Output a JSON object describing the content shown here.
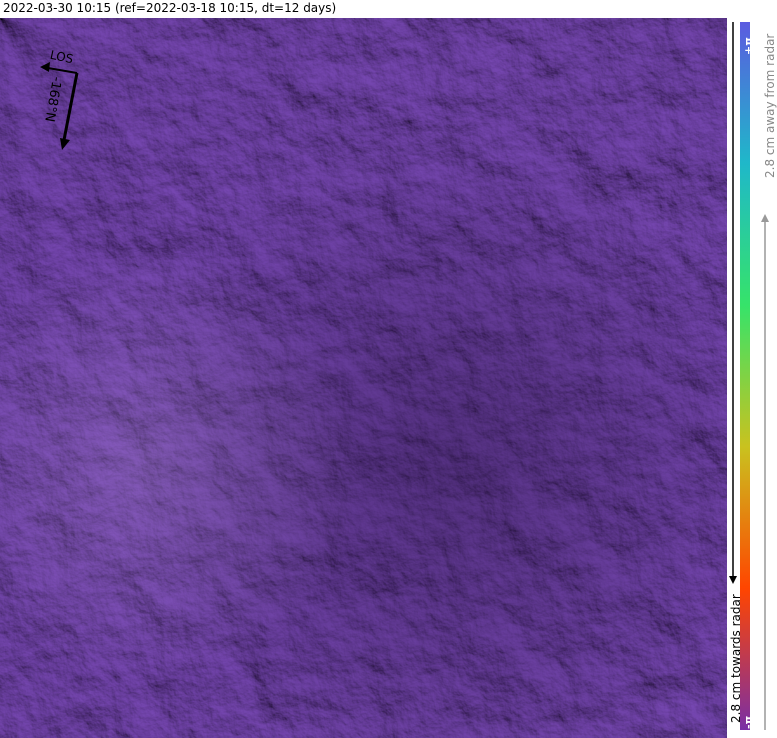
{
  "header": {
    "title": "2022-03-30 10:15 (ref=2022-03-18 10:15, dt=12 days)"
  },
  "map": {
    "base_color": "#6a3fa0",
    "compass": {
      "los_label": "LOS",
      "heading_label": "-168°N"
    }
  },
  "colorbar": {
    "max_label": "+π",
    "min_label": "-π",
    "away_label": "2.8 cm away from radar",
    "towards_label": "2.8 cm towards radar",
    "colors": [
      "#7a2fa6",
      "#ff4500",
      "#c9c21f",
      "#36e36a",
      "#1fb8c9",
      "#5b5be0"
    ]
  }
}
